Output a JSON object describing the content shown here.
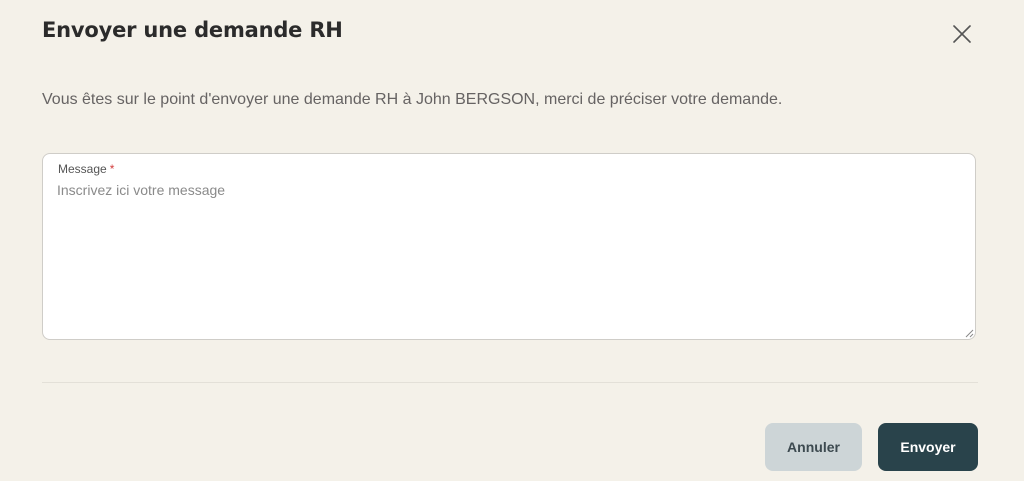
{
  "dialog": {
    "title": "Envoyer une demande RH",
    "close_icon": "close-icon",
    "description": "Vous êtes sur le point d'envoyer une demande RH à John BERGSON, merci de préciser votre demande."
  },
  "form": {
    "message": {
      "label": "Message",
      "required_marker": "*",
      "value": "",
      "placeholder": "Inscrivez ici votre message"
    }
  },
  "actions": {
    "cancel_label": "Annuler",
    "send_label": "Envoyer"
  },
  "colors": {
    "background": "#f4f1e9",
    "primary_button": "#29434b",
    "secondary_button": "#cdd5d7",
    "required": "#d23c3c"
  }
}
